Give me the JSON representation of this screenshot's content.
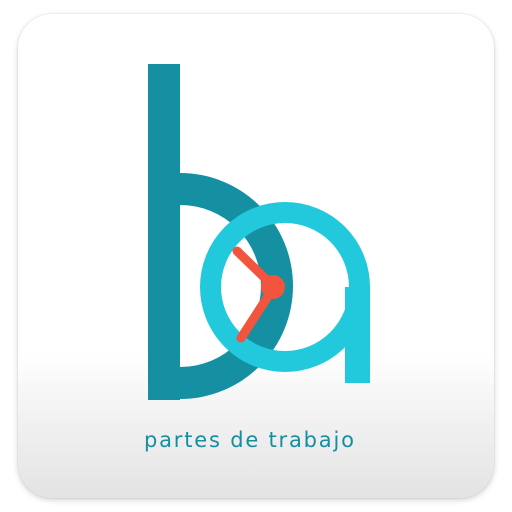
{
  "logo": {
    "icon_name": "ka-clock-logo",
    "tagline": "partes de trabajo"
  },
  "colors": {
    "teal_dark": "#1490a2",
    "cyan_light": "#22c9dd",
    "clock_hands": "#f2543d",
    "tagline": "#158e9f"
  }
}
